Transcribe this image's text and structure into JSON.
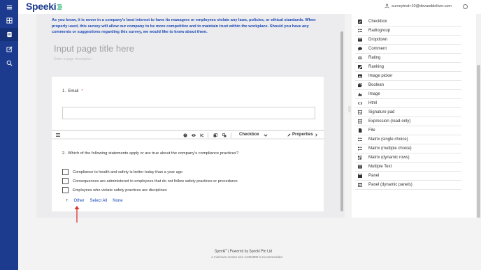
{
  "header": {
    "logo_text": "Speeki",
    "user_email": "surveytest+10@devanddeliver.com"
  },
  "sidebar": {
    "items": [
      {
        "icon": "menu-icon"
      },
      {
        "icon": "grid-icon"
      },
      {
        "icon": "survey-icon"
      },
      {
        "icon": "edit-icon"
      },
      {
        "icon": "search-icon"
      }
    ]
  },
  "survey": {
    "intro_text": "As you know, it is never in a company's best interest to have its managers or employees violate any laws, policies, or ethical standards. When properly used, this survey will allow our company to be more competitive and to maintain trust within the workplace. Should you have any comments or suggestions regarding this survey, we would like to know about them.",
    "page_title_placeholder": "Input page title here",
    "page_desc_placeholder": "Enter a page description",
    "question1": {
      "number": "1.",
      "title": "Email",
      "required_mark": "*"
    },
    "question2": {
      "number": "2.",
      "title": "Which of the following statements apply or are true about the company's compliance practices?",
      "choices": [
        "Compliance to health and safety is better today than a year ago",
        "Consequences are administered to employees that do not follow safety practices or procedures",
        "Employees who violate safety practices are disciplines"
      ],
      "add_symbol": "+",
      "option_links": [
        "Other",
        "Select All",
        "None"
      ]
    },
    "toolbar": {
      "type_label": "Checkbox",
      "properties_label": "Properties"
    }
  },
  "toolbox": {
    "items": [
      {
        "label": "Checkbox",
        "icon": "checkbox-icon"
      },
      {
        "label": "Radiogroup",
        "icon": "radiogroup-icon"
      },
      {
        "label": "Dropdown",
        "icon": "dropdown-icon"
      },
      {
        "label": "Comment",
        "icon": "comment-icon"
      },
      {
        "label": "Rating",
        "icon": "rating-icon"
      },
      {
        "label": "Ranking",
        "icon": "ranking-icon"
      },
      {
        "label": "Image picker",
        "icon": "image-picker-icon"
      },
      {
        "label": "Boolean",
        "icon": "boolean-icon"
      },
      {
        "label": "Image",
        "icon": "image-icon"
      },
      {
        "label": "Html",
        "icon": "html-icon"
      },
      {
        "label": "Signature pad",
        "icon": "signature-icon"
      },
      {
        "label": "Expression (read-only)",
        "icon": "expression-icon"
      },
      {
        "label": "File",
        "icon": "file-icon"
      },
      {
        "label": "Matrix (single choice)",
        "icon": "matrix-single-icon"
      },
      {
        "label": "Matrix (multiple choice)",
        "icon": "matrix-multiple-icon"
      },
      {
        "label": "Matrix (dynamic rows)",
        "icon": "matrix-dynamic-icon"
      },
      {
        "label": "Multiple Text",
        "icon": "multiple-text-icon"
      },
      {
        "label": "Panel",
        "icon": "panel-icon"
      },
      {
        "label": "Panel (dynamic panels)",
        "icon": "panel-dynamic-icon"
      }
    ]
  },
  "footer": {
    "brand": "Speeki",
    "powered_by": "Powered by Speeki Pte Ltd",
    "note": "A minimum screen size 1440x900 is recommended"
  },
  "colors": {
    "sidebar_bg": "#1c3b8f",
    "accent_blue": "#1a48b8",
    "arrow_red": "#d9342b"
  }
}
